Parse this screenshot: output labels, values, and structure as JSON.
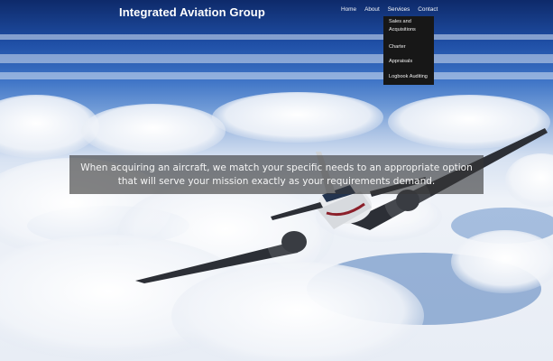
{
  "header": {
    "site_title": "Integrated Aviation Group",
    "nav": [
      {
        "label": "Home"
      },
      {
        "label": "About"
      },
      {
        "label": "Services"
      },
      {
        "label": "Contact"
      }
    ]
  },
  "services_menu": {
    "items": [
      {
        "line1": "Sales and",
        "line2": "Acquisitions"
      },
      {
        "label": "Charter"
      },
      {
        "label": "Appraisals"
      },
      {
        "label": "Logbook Auditing"
      }
    ]
  },
  "hero": {
    "caption": "When acquiring an aircraft, we match your specific needs to an appropriate option that will serve your mission exactly as your requirements demand."
  }
}
